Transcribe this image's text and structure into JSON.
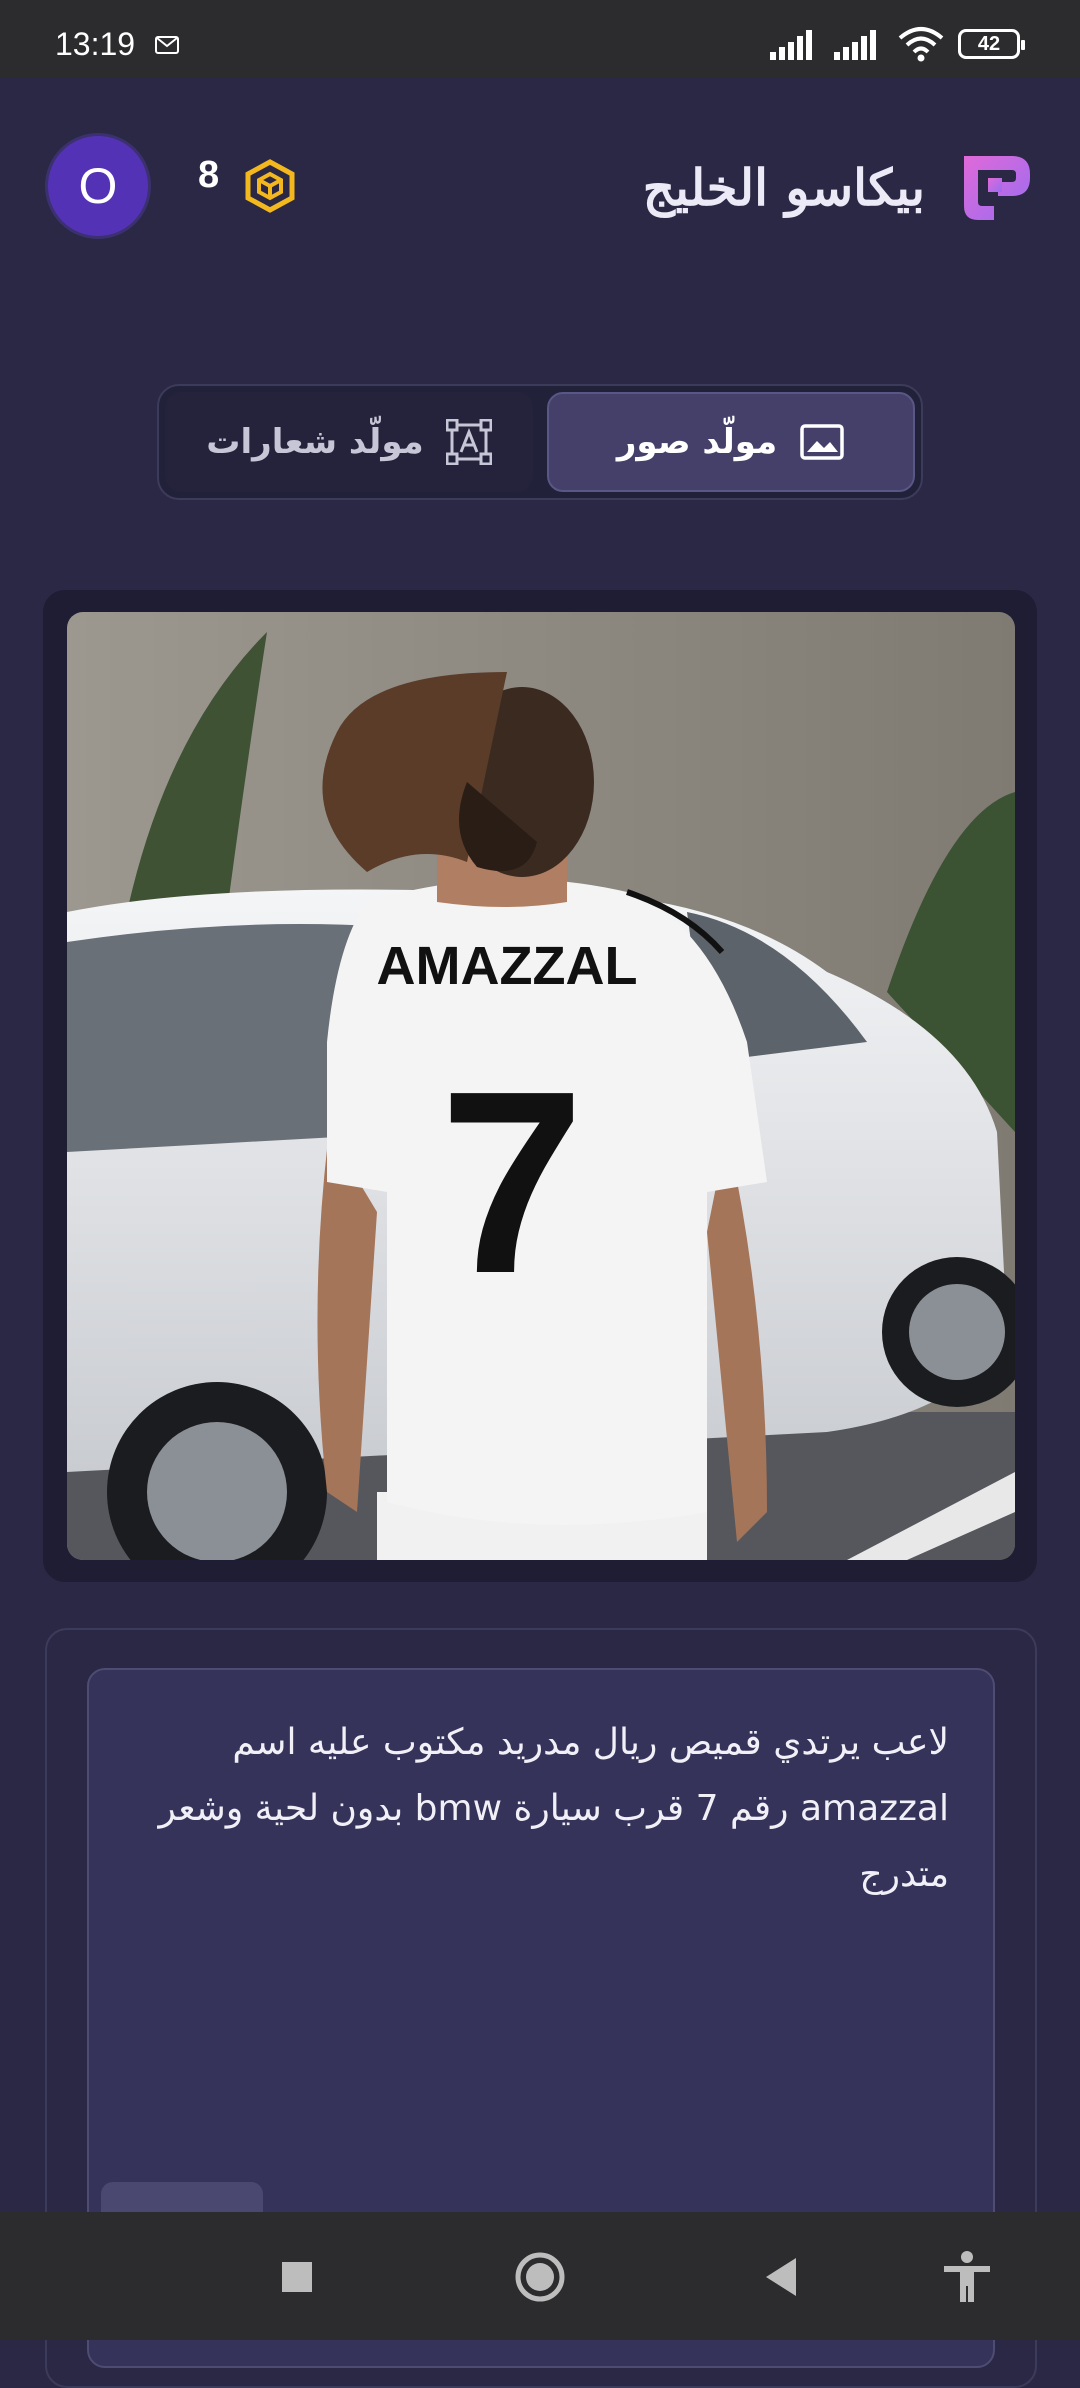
{
  "status_bar": {
    "time": "13:19",
    "battery": "42",
    "icons": [
      "mail-icon",
      "signal-icon",
      "signal-icon",
      "wifi-icon",
      "battery-icon"
    ]
  },
  "header": {
    "avatar_letter": "O",
    "credits": "8",
    "credits_icon": "coin-icon",
    "brand_name": "بيكاسو الخليج",
    "brand_logo_icon": "brand-logo-icon"
  },
  "tabs": [
    {
      "label": "مولّد صور",
      "icon": "image-icon",
      "active": true
    },
    {
      "label": "مولّد شعارات",
      "icon": "text-frame-icon",
      "active": false
    }
  ],
  "generated_image": {
    "jersey_name": "AMAZZAL",
    "jersey_number": "7"
  },
  "prompt": {
    "text": "لاعب يرتدي قميص ريال مدريد مكتوب عليه اسم amazzal رقم 7 قرب  سيارة  bmw بدون لحية وشعر متدرج"
  },
  "nav_bar": {
    "icons": [
      "stop-square-icon",
      "home-circle-icon",
      "back-triangle-icon",
      "accessibility-icon"
    ]
  },
  "colors": {
    "background": "#2a2845",
    "avatar": "#5432b5",
    "coin": "#f3b81e",
    "brand_gradient_start": "#e06ad9",
    "brand_gradient_end": "#9a6cf0",
    "active_tab": "#44406a"
  }
}
